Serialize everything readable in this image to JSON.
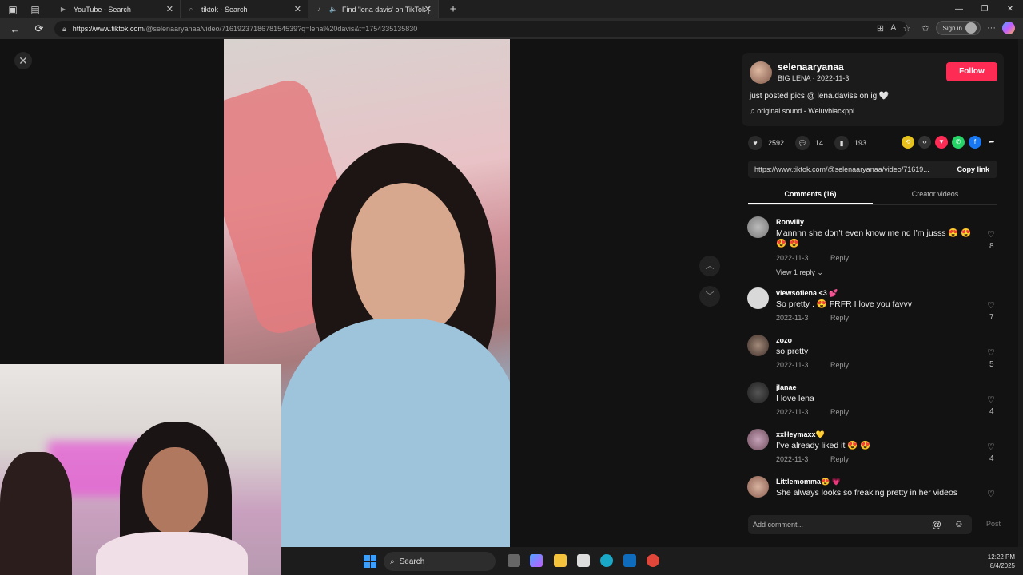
{
  "browser": {
    "tabs": [
      {
        "label": "YouTube - Search"
      },
      {
        "label": "tiktok - Search"
      },
      {
        "label": "Find 'lena davis' on TikTok |"
      }
    ],
    "new_tab": "+",
    "url_host": "https://www.tiktok.com",
    "url_path": "/@selenaaryanaa/video/7161923718678154539?q=lena%20davis&t=1754335135830",
    "sign_in_label": "Sign in"
  },
  "video": {
    "close_label": "✕",
    "up_label": "︿",
    "down_label": "﹀"
  },
  "post": {
    "username": "selenaaryanaa",
    "subtitle": "BIG LENA · 2022-11-3",
    "follow_label": "Follow",
    "caption": "just posted pics @ lena.daviss on ig 🤍",
    "sound": "♫  original sound - Weluvblackppl",
    "likes": "2592",
    "comments_count": "14",
    "saves": "193",
    "link": "https://www.tiktok.com/@selenaaryanaa/video/71619...",
    "copy_link_label": "Copy link",
    "tab_comments": "Comments (16)",
    "tab_creator": "Creator videos"
  },
  "comments": [
    {
      "name": "Ronvilly",
      "text": "Mannnn she don’t even know me nd I’m jusss 😍 😍 😍 😍",
      "date": "2022-11-3",
      "reply": "Reply",
      "likes": "8",
      "view_replies": "View 1 reply ⌄"
    },
    {
      "name": "viewsoflena  <3  💕",
      "text": "So pretty . 😍 FRFR I love you favvv",
      "date": "2022-11-3",
      "reply": "Reply",
      "likes": "7"
    },
    {
      "name": "zozo",
      "text": "so pretty",
      "date": "2022-11-3",
      "reply": "Reply",
      "likes": "5"
    },
    {
      "name": "jlanae",
      "text": "I love lena",
      "date": "2022-11-3",
      "reply": "Reply",
      "likes": "4"
    },
    {
      "name": "xxHeymaxx💛",
      "text": "I’ve already liked it 😍 😍",
      "date": "2022-11-3",
      "reply": "Reply",
      "likes": "4"
    },
    {
      "name": "Littlemomma😍 💗",
      "text": "She always looks so freaking pretty in her videos",
      "date": "",
      "reply": "",
      "likes": ""
    }
  ],
  "comment_box": {
    "placeholder": "Add comment...",
    "post_label": "Post"
  },
  "taskbar": {
    "search_label": "Search",
    "time": "12:22 PM",
    "date": "8/4/2025"
  },
  "colors": {
    "follow": "#fe2c55",
    "accent": "#3aa0ff"
  }
}
